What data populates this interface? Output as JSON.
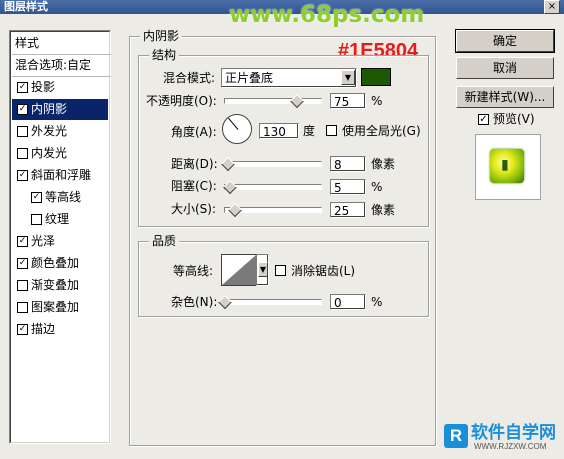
{
  "window": {
    "title": "图层样式",
    "close_glyph": "×"
  },
  "watermark": "www.68ps.com",
  "annotation": "#1E5804",
  "bottom_logo": {
    "mark": "R",
    "name": "软件自学网",
    "url": "WWW.RJZXW.COM"
  },
  "style_list": {
    "header": "样式",
    "blend_options": "混合选项:自定",
    "items": [
      {
        "label": "投影",
        "checked": true
      },
      {
        "label": "内阴影",
        "checked": true,
        "selected": true
      },
      {
        "label": "外发光",
        "checked": false
      },
      {
        "label": "内发光",
        "checked": false
      },
      {
        "label": "斜面和浮雕",
        "checked": true
      },
      {
        "label": "等高线",
        "checked": true,
        "sub": true
      },
      {
        "label": "纹理",
        "checked": false,
        "sub": true
      },
      {
        "label": "光泽",
        "checked": true
      },
      {
        "label": "颜色叠加",
        "checked": true
      },
      {
        "label": "渐变叠加",
        "checked": false
      },
      {
        "label": "图案叠加",
        "checked": false
      },
      {
        "label": "描边",
        "checked": true
      }
    ]
  },
  "panel": {
    "title": "内阴影",
    "structure": {
      "title": "结构",
      "blend_mode_label": "混合模式:",
      "blend_mode": "正片叠底",
      "color": "#1e5804",
      "opacity_label": "不透明度(O):",
      "opacity": "75",
      "opacity_fraction": 0.75,
      "opacity_unit": "%",
      "angle_label": "角度(A):",
      "angle": "130",
      "angle_degrees": 130,
      "angle_unit": "度",
      "global_light_label": "使用全局光(G)",
      "global_light": false,
      "distance_label": "距离(D):",
      "distance": "8",
      "distance_unit": "像素",
      "distance_fraction": 0.03,
      "choke_label": "阻塞(C):",
      "choke": "5",
      "choke_unit": "%",
      "choke_fraction": 0.05,
      "size_label": "大小(S):",
      "size": "25",
      "size_unit": "像素",
      "size_fraction": 0.1
    },
    "quality": {
      "title": "品质",
      "contour_label": "等高线:",
      "anti_alias_label": "消除锯齿(L)",
      "anti_alias": false,
      "noise_label": "杂色(N):",
      "noise": "0",
      "noise_unit": "%",
      "noise_fraction": 0
    }
  },
  "buttons": {
    "ok": "确定",
    "cancel": "取消",
    "new_style": "新建样式(W)...",
    "preview_label": "预览(V)",
    "preview_checked": true
  },
  "colors": {
    "selection": "#0a246a",
    "accent_swatch": "#1e5804",
    "annotation": "#e61c1c"
  }
}
